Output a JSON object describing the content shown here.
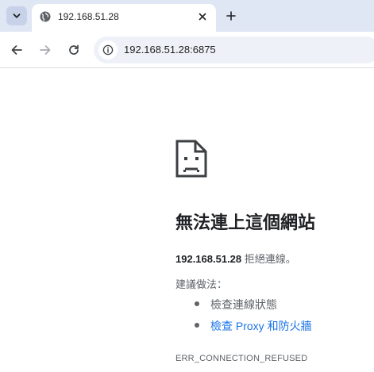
{
  "browser": {
    "tab": {
      "title": "192.168.51.28",
      "favicon": "globe-icon"
    },
    "omnibox": {
      "url": "192.168.51.28:6875"
    },
    "icons": {
      "tab_search": "chevron-down-icon",
      "tab_close": "close-icon",
      "new_tab": "plus-icon",
      "back": "back-arrow-icon",
      "forward": "forward-arrow-icon",
      "reload": "reload-icon",
      "site_info": "info-icon"
    }
  },
  "error_page": {
    "icon": "sad-page-icon",
    "title": "無法連上這個網站",
    "host": "192.168.51.28",
    "message": " 拒絕連線。",
    "suggestions_heading": "建議做法：",
    "suggestions": [
      {
        "label": "檢查連線狀態",
        "link": false
      },
      {
        "label": "檢查 Proxy 和防火牆",
        "link": true
      }
    ],
    "error_code": "ERR_CONNECTION_REFUSED"
  },
  "colors": {
    "tabstrip": "#dfe6f4",
    "omnibox": "#eef1f7",
    "link": "#1a73e8",
    "text": "#202124",
    "secondary_text": "#5f6368"
  }
}
